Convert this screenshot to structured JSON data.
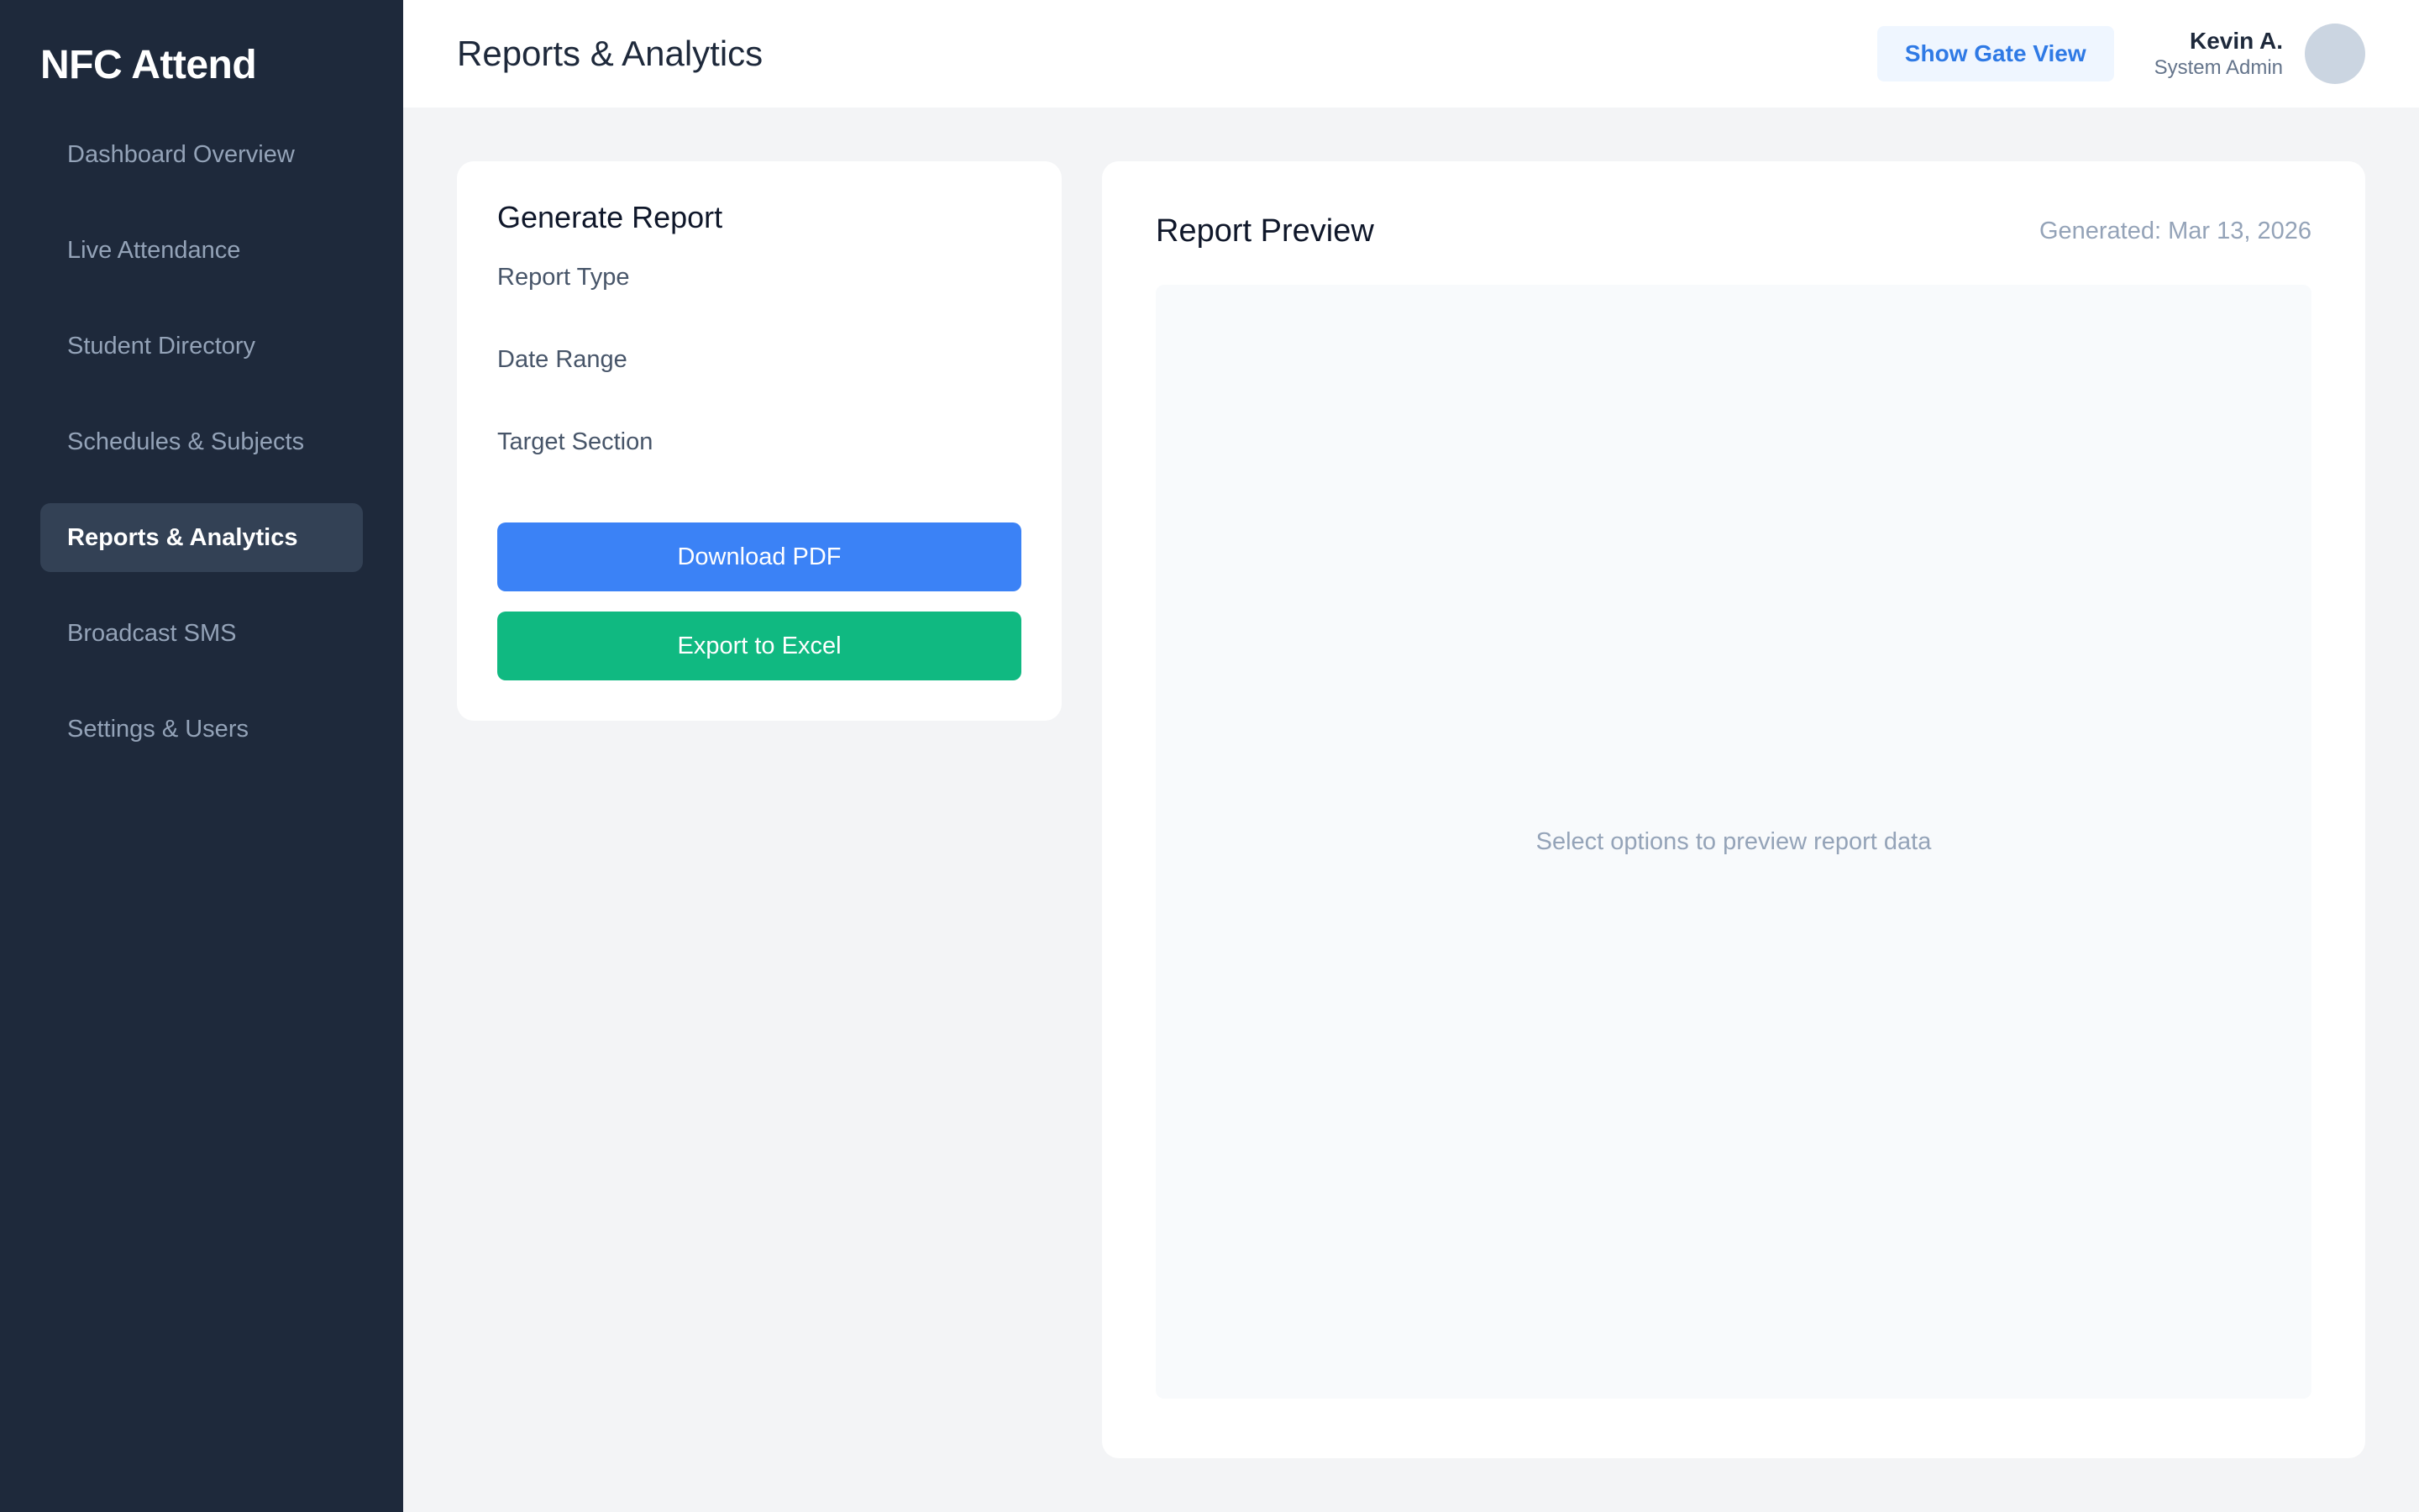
{
  "sidebar": {
    "brand": "NFC Attend",
    "items": [
      {
        "label": "Dashboard Overview"
      },
      {
        "label": "Live Attendance"
      },
      {
        "label": "Student Directory"
      },
      {
        "label": "Schedules & Subjects"
      },
      {
        "label": "Reports & Analytics",
        "active": true
      },
      {
        "label": "Broadcast SMS"
      },
      {
        "label": "Settings & Users"
      }
    ]
  },
  "header": {
    "title": "Reports & Analytics",
    "gate_button": "Show Gate View",
    "user": {
      "name": "Kevin A.",
      "role": "System Admin"
    }
  },
  "generate": {
    "title": "Generate Report",
    "fields": [
      {
        "label": "Report Type"
      },
      {
        "label": "Date Range"
      },
      {
        "label": "Target Section"
      }
    ],
    "pdf_button": "Download PDF",
    "excel_button": "Export to Excel"
  },
  "preview": {
    "title": "Report Preview",
    "generated": "Generated: Mar 13, 2026",
    "empty_text": "Select options to preview report data"
  },
  "colors": {
    "sidebar_bg": "#1e293b",
    "active_item_bg": "#334155",
    "primary": "#3b82f6",
    "success": "#10b981",
    "gate_button_text": "#2f7ae5"
  }
}
